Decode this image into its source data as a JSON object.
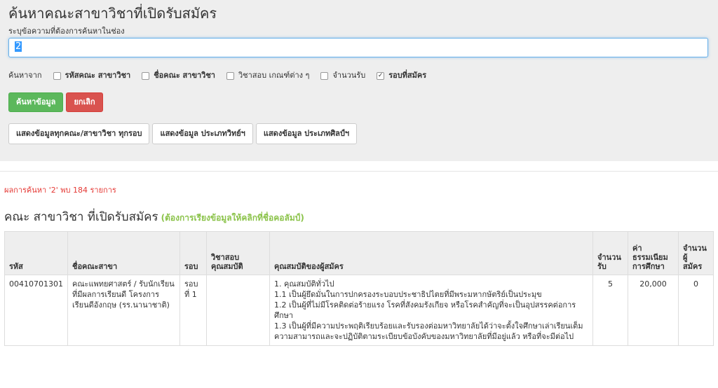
{
  "header": {
    "title": "ค้นหาคณะสาขาวิชาที่เปิดรับสมัคร",
    "hint": "ระบุข้อความที่ต้องการค้นหาในช่อง"
  },
  "search": {
    "value": "2"
  },
  "filters": {
    "label": "ค้นหาจาก",
    "options": [
      {
        "label": "รหัสคณะ สาขาวิชา",
        "checked": false
      },
      {
        "label": "ชื่อคณะ สาขาวิชา",
        "checked": false
      },
      {
        "label": "วิชาสอบ เกณฑ์ต่าง ๆ",
        "checked": false
      },
      {
        "label": "จำนวนรับ",
        "checked": false
      },
      {
        "label": "รอบที่สมัคร",
        "checked": true
      }
    ]
  },
  "actions": {
    "search_label": "ค้นหาข้อมูล",
    "cancel_label": "ยกเลิก",
    "show_all_label": "แสดงข้อมูลทุกคณะ/สาขาวิชา ทุกรอบ",
    "show_sci_label": "แสดงข้อมูล ประเภทวิทย์ฯ",
    "show_arts_label": "แสดงข้อมูล ประเภทศิลป์ฯ"
  },
  "result_text": "ผลการค้นหา '2' พบ 184 รายการ",
  "section": {
    "title": "คณะ สาขาวิชา ที่เปิดรับสมัคร",
    "note": "(ต้องการเรียงข้อมูลให้คลิกที่ชื่อคอลัมป์)"
  },
  "table": {
    "headers": {
      "code": "รหัส",
      "name": "ชื่อคณะสาขา",
      "round": "รอบ",
      "exam": "วิชาสอบ คุณสมบัติ",
      "qual": "คุณสมบัติของผู้สมัคร",
      "accept": "จำนวน รับ",
      "fee": "ค่า ธรรมเนียม การศึกษา",
      "applicants": "จำนวน ผู้ สมัคร"
    },
    "rows": [
      {
        "code": "00410701301",
        "name": "คณะแพทยศาสตร์ / รับนักเรียนที่มีผลการเรียนดี โครงการเรียนดีอังกฤษ (รร.นานาชาติ)",
        "round": "รอบ ที่ 1",
        "exam": "",
        "qual": [
          "1. คุณสมบัติทั่วไป",
          "1.1 เป็นผู้ยึดมั่นในการปกครองระบอบประชาธิปไตยที่มีพระมหากษัตริย์เป็นประมุข",
          "1.2 เป็นผู้ที่ไม่มีโรคติดต่อร้ายแรง โรคที่สังคมรังเกียจ หรือโรคสำคัญที่จะเป็นอุปสรรคต่อการศึกษา",
          "1.3 เป็นผู้ที่มีความประพฤติเรียบร้อยและรับรองต่อมหาวิทยาลัยได้ว่าจะตั้งใจศึกษาเล่าเรียนเต็ม",
          "ความสามารถและจะปฏิบัติตามระเบียบข้อบังคับของมหาวิทยาลัยที่มีอยู่แล้ว หรือที่จะมีต่อไป"
        ],
        "accept": "5",
        "fee": "20,000",
        "applicants": "0"
      }
    ]
  }
}
